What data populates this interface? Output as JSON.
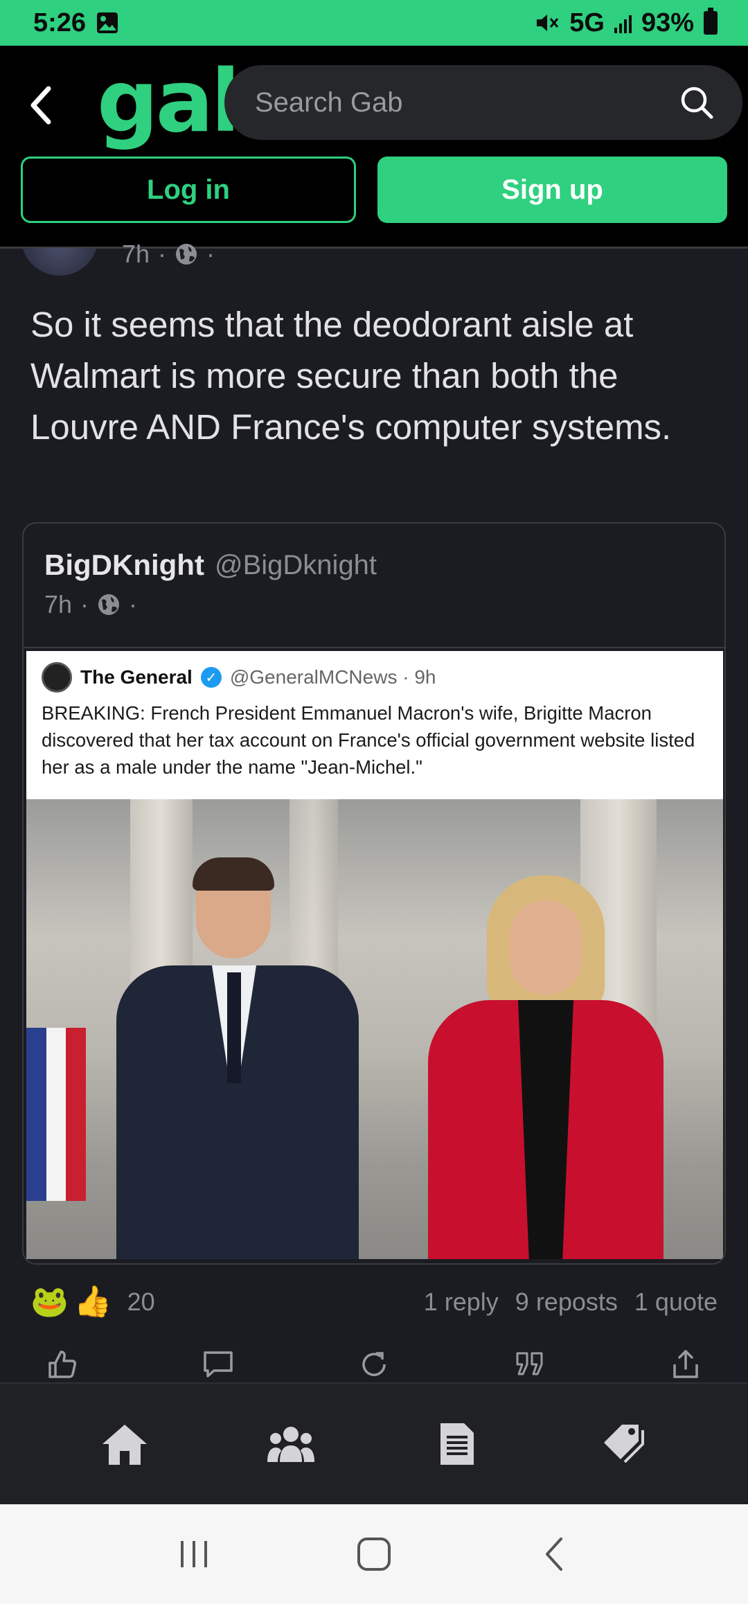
{
  "status_bar": {
    "time": "5:26",
    "network": "5G",
    "battery": "93%",
    "icons": [
      "gallery-icon",
      "mute-icon",
      "signal-icon",
      "battery-icon"
    ]
  },
  "header": {
    "logo": "gab",
    "search_placeholder": "Search Gab",
    "login_label": "Log in",
    "signup_label": "Sign up"
  },
  "post": {
    "time": "7h",
    "separator": "·",
    "text": "So it seems that the deodorant aisle at Walmart is more secure than both the Louvre AND France's computer systems."
  },
  "quote": {
    "author_name": "BigDKnight",
    "author_handle": "@BigDknight",
    "time": "7h",
    "separator": "·",
    "embedded": {
      "name": "The General",
      "handle_time": "@GeneralMCNews · 9h",
      "text": "BREAKING: French President Emmanuel Macron's wife, Brigitte Macron discovered that her tax account on France's official government website listed her as a male under the name \"Jean-Michel.\""
    }
  },
  "stats": {
    "reactions": [
      "🐸",
      "👍"
    ],
    "reaction_count": "20",
    "replies": "1 reply",
    "reposts": "9 reposts",
    "quotes": "1 quote"
  },
  "colors": {
    "accent": "#2fd07f",
    "background": "#1a1c22",
    "header": "#000000"
  }
}
